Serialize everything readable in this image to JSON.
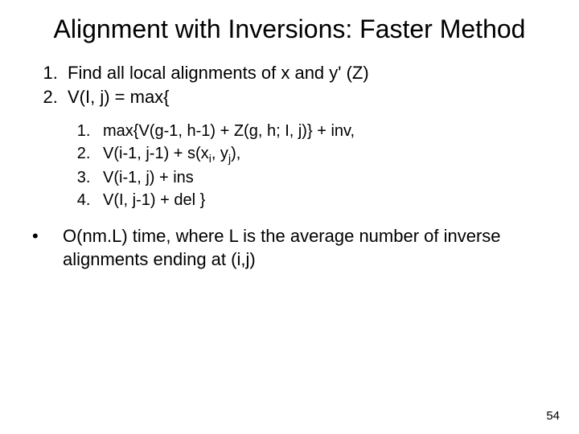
{
  "title": "Alignment with Inversions: Faster Method",
  "outer": {
    "item1": "Find all local alignments of x and y' (Z)",
    "item2": "V(I, j) = max{"
  },
  "inner": {
    "i1_pre": "max{V(g-1, h-1) + Z(g, h; I, j)} + inv,",
    "i2_pre": "V(i-1, j-1) + s(x",
    "i2_sub1": "i",
    "i2_mid": ", y",
    "i2_sub2": "j",
    "i2_post": "),",
    "i3": "V(i-1, j) + ins",
    "i4": "V(I, j-1) + del }"
  },
  "bullet": {
    "marker": "•",
    "text": "O(nm.L) time, where L is the average number of inverse alignments ending at (i,j)"
  },
  "page": "54"
}
